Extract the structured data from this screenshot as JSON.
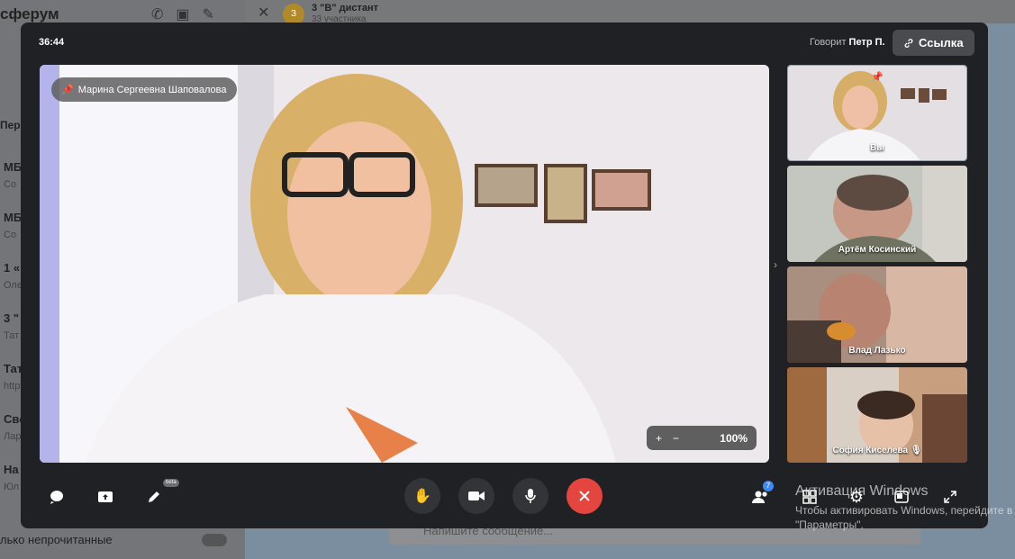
{
  "background": {
    "app_title": "сферум",
    "list_header": "Пере",
    "chat_list": [
      {
        "title": "МБ",
        "subtitle": "Co"
      },
      {
        "title": "МБ",
        "subtitle": "Co"
      },
      {
        "title": "1 «",
        "subtitle": "Оле"
      },
      {
        "title": "3 \"",
        "subtitle": "Тат"
      },
      {
        "title": "Тат",
        "subtitle": "http"
      },
      {
        "title": "Сво",
        "subtitle": "Лар"
      },
      {
        "title": "На",
        "subtitle": "Юл"
      }
    ],
    "unread_filter": "лько непрочитанные",
    "chat_title": "3 \"В\" дистант",
    "chat_subtitle": "33 участника",
    "chat_avatar_letter": "З",
    "message_placeholder": "Напишите сообщение..."
  },
  "call": {
    "timer": "36:44",
    "speaking_label": "Говорит",
    "speaking_name": "Петр П.",
    "link_button": "Ссылка",
    "main_pinned_name": "Марина Сергеевна Шаповалова",
    "zoom": {
      "plus": "+",
      "minus": "−",
      "value": "100%"
    },
    "participants": [
      {
        "name": "Вы",
        "pinned": true
      },
      {
        "name": "Артём Косинский"
      },
      {
        "name": "Влад Лазько"
      },
      {
        "name": "София Киселева",
        "muted": true
      }
    ],
    "participants_count_badge": "7",
    "draw_beta_label": "beta"
  },
  "system": {
    "activation_title": "Активация Windows",
    "activation_line1": "Чтобы активировать Windows, перейдите в",
    "activation_line2": "\"Параметры\"."
  },
  "colors": {
    "call_bg": "#202124",
    "hangup": "#e5453f",
    "accent": "#3d8af7"
  }
}
